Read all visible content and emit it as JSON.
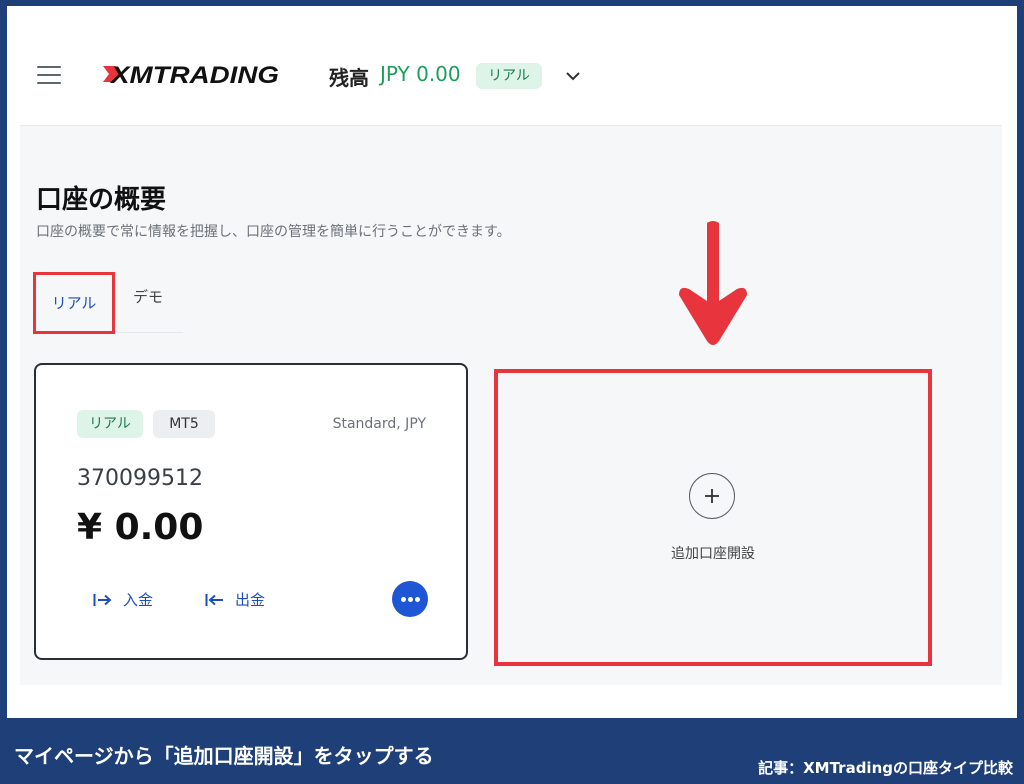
{
  "header": {
    "logo_text": "XMTRADING",
    "balance_label": "残高",
    "balance_value": "JPY 0.00",
    "account_badge": "リアル"
  },
  "page": {
    "title": "口座の概要",
    "subtitle": "口座の概要で常に情報を把握し、口座の管理を簡単に行うことができます。"
  },
  "tabs": [
    {
      "label": "リアル",
      "active": true
    },
    {
      "label": "デモ",
      "active": false
    }
  ],
  "account_card": {
    "tag_type": "リアル",
    "tag_platform": "MT5",
    "account_kind": "Standard, JPY",
    "account_number": "370099512",
    "balance": "¥ 0.00",
    "deposit_label": "入金",
    "withdraw_label": "出金"
  },
  "add_account": {
    "label": "追加口座開設"
  },
  "footer": {
    "instruction": "マイページから「追加口座開設」をタップする",
    "article": "記事：XMTradingの口座タイプ比較"
  },
  "colors": {
    "accent_blue": "#1f56d6",
    "highlight_red": "#e8343c",
    "positive_green": "#1f9e5a",
    "frame_navy": "#1e3f78"
  },
  "icons": [
    "menu-icon",
    "chevron-down-icon",
    "deposit-icon",
    "withdraw-icon",
    "more-icon",
    "plus-icon",
    "down-arrow-icon"
  ]
}
